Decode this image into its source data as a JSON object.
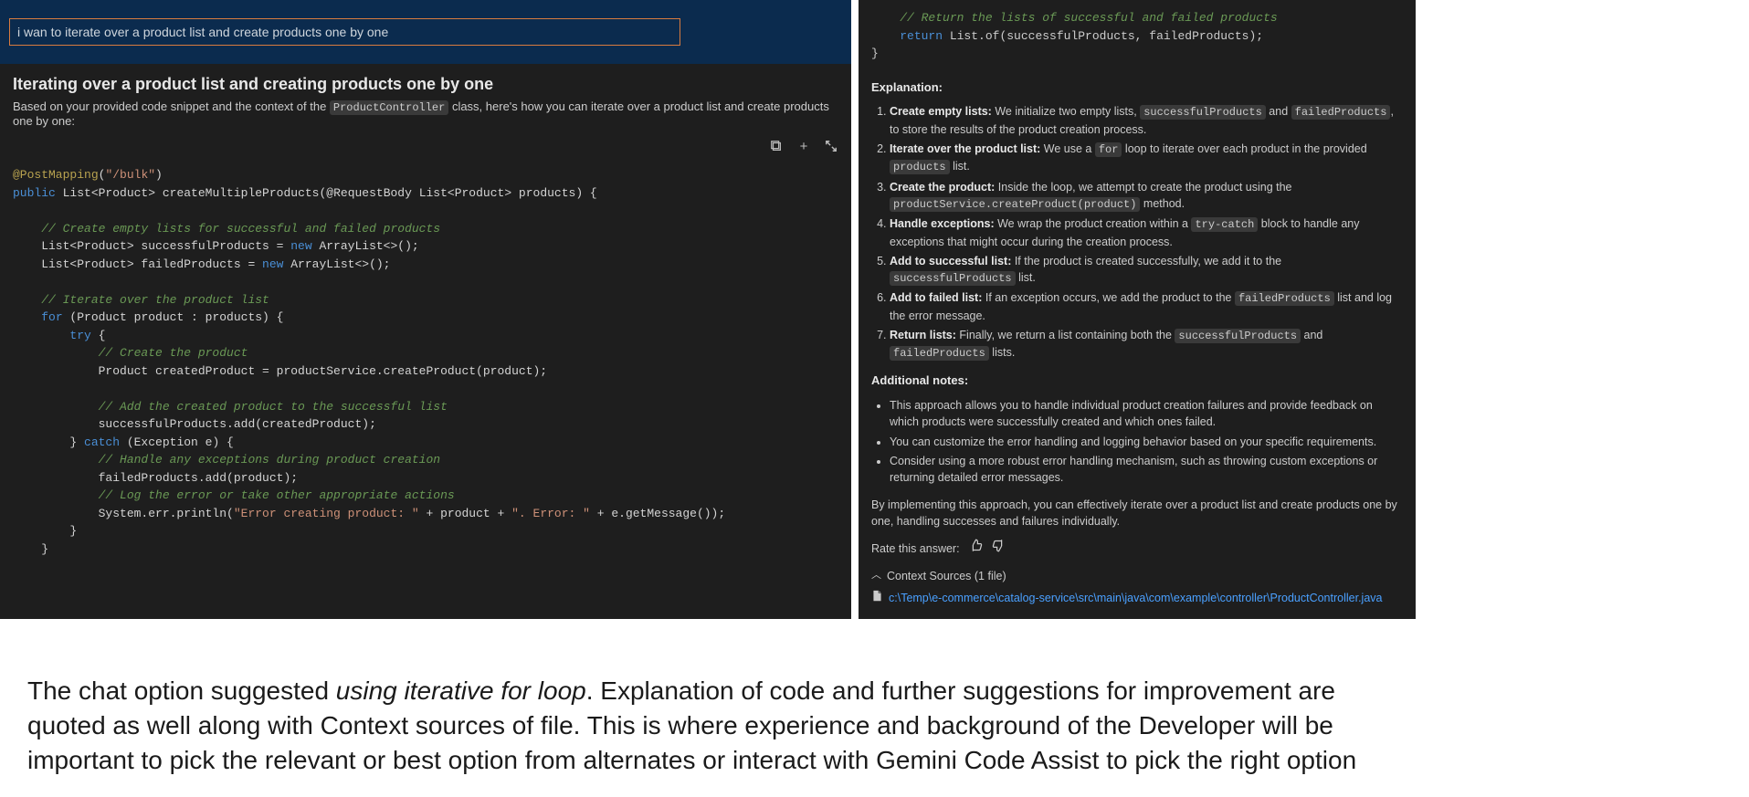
{
  "input": {
    "value": "i wan to iterate over a product list and create products one by one"
  },
  "answer": {
    "title": "Iterating over a product list and creating products one by one",
    "sub_pre": "Based on your provided code snippet and the context of the ",
    "sub_chip": "ProductController",
    "sub_post": " class, here's how you can iterate over a product list and create products one by one:"
  },
  "code_left": {
    "l1_ann": "@PostMapping",
    "l1_paren": "(",
    "l1_str": "\"/bulk\"",
    "l1_close": ")",
    "l2_pub": "public",
    "l2_type": " List<Product> ",
    "l2_fn": "createMultipleProducts",
    "l2_sig": "(@RequestBody List<Product> products) {",
    "c1": "    // Create empty lists for successful and failed products",
    "l3a": "    List<Product> successfulProducts = ",
    "l3new": "new",
    "l3b": " ArrayList<>();",
    "l4a": "    List<Product> failedProducts = ",
    "l4new": "new",
    "l4b": " ArrayList<>();",
    "c2": "    // Iterate over the product list",
    "l5a": "    ",
    "l5for": "for",
    "l5b": " (Product product : products) {",
    "l6a": "        ",
    "l6try": "try",
    "l6b": " {",
    "c3": "            // Create the product",
    "l7": "            Product createdProduct = productService.createProduct(product);",
    "c4": "            // Add the created product to the successful list",
    "l8": "            successfulProducts.add(createdProduct);",
    "l9a": "        } ",
    "l9catch": "catch",
    "l9b": " (Exception e) {",
    "c5": "            // Handle any exceptions during product creation",
    "l10": "            failedProducts.add(product);",
    "c6": "            // Log the error or take other appropriate actions",
    "l11a": "            System.err.println(",
    "l11s1": "\"Error creating product: \"",
    "l11b": " + product + ",
    "l11s2": "\". Error: \"",
    "l11c": " + e.getMessage());",
    "l12": "        }",
    "l13": "    }"
  },
  "code_right": {
    "c1": "    // Return the lists of successful and failed products",
    "l1a": "    ",
    "l1ret": "return",
    "l1b": " List.of(successfulProducts, failedProducts);",
    "l2": "}"
  },
  "exp": {
    "heading": "Explanation:",
    "items": [
      {
        "b": "Create empty lists:",
        "t1": " We initialize two empty lists, ",
        "chips": [
          "successfulProducts"
        ],
        "mid": " and ",
        "chips2": [
          "failedProducts"
        ],
        "t2": ", to store the results of the product creation process."
      },
      {
        "b": "Iterate over the product list:",
        "t1": " We use a ",
        "chips": [
          "for"
        ],
        "mid": " loop to iterate over each product in the provided ",
        "chips2": [
          "products"
        ],
        "t2": " list."
      },
      {
        "b": "Create the product:",
        "t1": " Inside the loop, we attempt to create the product using the ",
        "chips": [
          "productService.createProduct(product)"
        ],
        "mid": "",
        "chips2": [],
        "t2": " method."
      },
      {
        "b": "Handle exceptions:",
        "t1": " We wrap the product creation within a ",
        "chips": [
          "try-catch"
        ],
        "mid": "",
        "chips2": [],
        "t2": " block to handle any exceptions that might occur during the creation process."
      },
      {
        "b": "Add to successful list:",
        "t1": " If the product is created successfully, we add it to the ",
        "chips": [
          "successfulProducts"
        ],
        "mid": "",
        "chips2": [],
        "t2": " list."
      },
      {
        "b": "Add to failed list:",
        "t1": " If an exception occurs, we add the product to the ",
        "chips": [
          "failedProducts"
        ],
        "mid": "",
        "chips2": [],
        "t2": " list and log the error message."
      },
      {
        "b": "Return lists:",
        "t1": " Finally, we return a list containing both the ",
        "chips": [
          "successfulProducts"
        ],
        "mid": " and ",
        "chips2": [
          "failedProducts"
        ],
        "t2": " lists."
      }
    ]
  },
  "notes": {
    "heading": "Additional notes:",
    "items": [
      "This approach allows you to handle individual product creation failures and provide feedback on which products were successfully created and which ones failed.",
      "You can customize the error handling and logging behavior based on your specific requirements.",
      "Consider using a more robust error handling mechanism, such as throwing custom exceptions or returning detailed error messages."
    ],
    "closing": "By implementing this approach, you can effectively iterate over a product list and create products one by one, handling successes and failures individually."
  },
  "rate": {
    "label": "Rate this answer:"
  },
  "context": {
    "label": "Context Sources (1 file)",
    "file": "c:\\Temp\\e-commerce\\catalog-service\\src\\main\\java\\com\\example\\controller\\ProductController.java"
  },
  "narrative": {
    "pre": "The chat option suggested ",
    "ital": "using iterative for loop",
    "post": ". Explanation of code and further suggestions for improvement are quoted as well along with Context sources of file. This is where experience and background of the Developer will be important to pick the relevant or best option from alternates or interact with Gemini Code Assist to pick the right option"
  }
}
